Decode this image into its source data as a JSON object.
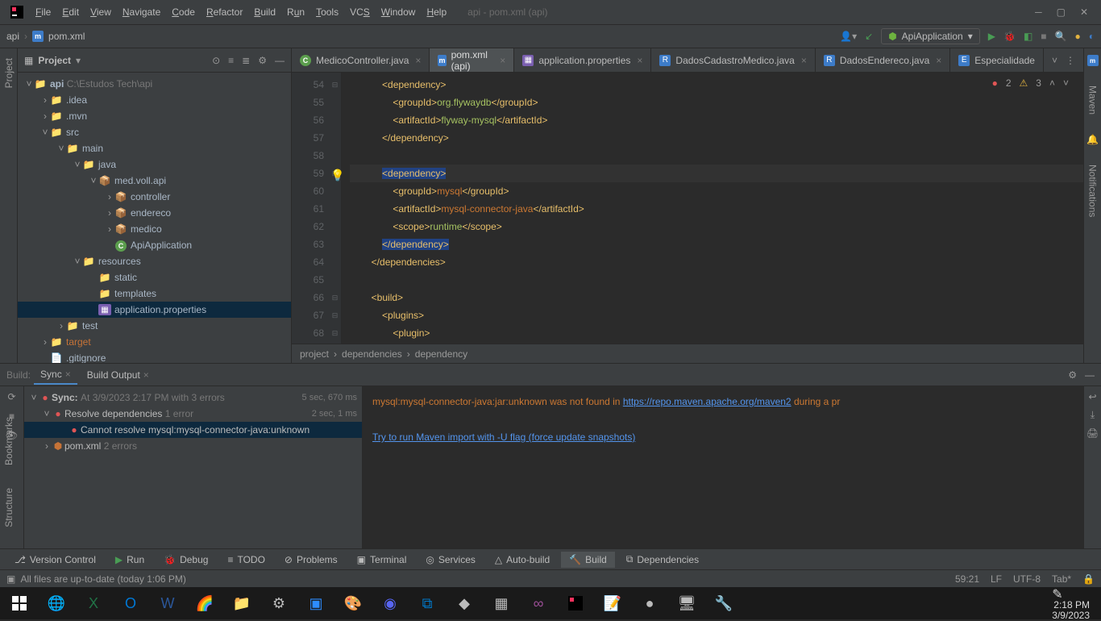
{
  "window": {
    "title": "api - pom.xml (api)"
  },
  "menu": [
    "File",
    "Edit",
    "View",
    "Navigate",
    "Code",
    "Refactor",
    "Build",
    "Run",
    "Tools",
    "VCS",
    "Window",
    "Help"
  ],
  "breadcrumb": {
    "root": "api",
    "file": "pom.xml"
  },
  "run_config": "ApiApplication",
  "project_panel": {
    "title": "Project"
  },
  "tree": {
    "root": {
      "name": "api",
      "path": "C:\\Estudos Tech\\api"
    },
    "idea": ".idea",
    "mvn": ".mvn",
    "src": "src",
    "main": "main",
    "java": "java",
    "pkg": "med.voll.api",
    "controller": "controller",
    "endereco": "endereco",
    "medico": "medico",
    "appclass": "ApiApplication",
    "resources": "resources",
    "static": "static",
    "templates": "templates",
    "appprops": "application.properties",
    "test": "test",
    "target": "target",
    "gitignore": ".gitignore"
  },
  "tabs": [
    {
      "label": "MedicoController.java",
      "active": false,
      "type": "c"
    },
    {
      "label": "pom.xml (api)",
      "active": true,
      "type": "m"
    },
    {
      "label": "application.properties",
      "active": false,
      "type": "p"
    },
    {
      "label": "DadosCadastroMedico.java",
      "active": false,
      "type": "r"
    },
    {
      "label": "DadosEndereco.java",
      "active": false,
      "type": "r"
    },
    {
      "label": "Especialidade",
      "active": false,
      "type": "r"
    }
  ],
  "inspector": {
    "errors": "2",
    "warnings": "3"
  },
  "code": {
    "lines": [
      54,
      55,
      56,
      57,
      58,
      59,
      60,
      61,
      62,
      63,
      64,
      65,
      66,
      67,
      68
    ],
    "content": [
      {
        "indent": 12,
        "html": "<span class='t-tag'>&lt;dependency&gt;</span>"
      },
      {
        "indent": 16,
        "html": "<span class='t-tag'>&lt;groupId&gt;</span><span class='t-val'>org.flywaydb</span><span class='t-tag'>&lt;/groupId&gt;</span>"
      },
      {
        "indent": 16,
        "html": "<span class='t-tag'>&lt;artifactId&gt;</span><span class='t-val'>flyway-mysql</span><span class='t-tag'>&lt;/artifactId&gt;</span>"
      },
      {
        "indent": 12,
        "html": "<span class='t-tag'>&lt;/dependency&gt;</span>"
      },
      {
        "indent": 0,
        "html": ""
      },
      {
        "indent": 12,
        "html": "<span class='t-tag t-hl'>&lt;dependency&gt;</span>",
        "current": true
      },
      {
        "indent": 16,
        "html": "<span class='t-tag'>&lt;groupId&gt;</span><span class='t-err'>mysql</span><span class='t-tag'>&lt;/groupId&gt;</span>"
      },
      {
        "indent": 16,
        "html": "<span class='t-tag'>&lt;artifactId&gt;</span><span class='t-err'>mysql-connector-java</span><span class='t-tag'>&lt;/artifactId&gt;</span>"
      },
      {
        "indent": 16,
        "html": "<span class='t-tag'>&lt;scope&gt;</span><span class='t-val'>runtime</span><span class='t-tag'>&lt;/scope&gt;</span>"
      },
      {
        "indent": 12,
        "html": "<span class='t-tag t-hl'>&lt;/dependency&gt;</span>"
      },
      {
        "indent": 8,
        "html": "<span class='t-tag'>&lt;/dependencies&gt;</span>"
      },
      {
        "indent": 0,
        "html": ""
      },
      {
        "indent": 8,
        "html": "<span class='t-tag'>&lt;build&gt;</span>"
      },
      {
        "indent": 12,
        "html": "<span class='t-tag'>&lt;plugins&gt;</span>"
      },
      {
        "indent": 16,
        "html": "<span class='t-tag'>&lt;plugin&gt;</span>"
      }
    ]
  },
  "structure_crumb": [
    "project",
    "dependencies",
    "dependency"
  ],
  "build_tabs": {
    "build": "Build:",
    "sync": "Sync",
    "output": "Build Output"
  },
  "build_tree": {
    "sync": {
      "label": "Sync:",
      "detail": "At 3/9/2023 2:17 PM with 3 errors",
      "time": "5 sec, 670 ms"
    },
    "resolve": {
      "label": "Resolve dependencies",
      "detail": "1 error",
      "time": "2 sec, 1 ms"
    },
    "cannot": "Cannot resolve mysql:mysql-connector-java:unknown",
    "pom": {
      "label": "pom.xml",
      "detail": "2 errors"
    }
  },
  "build_output": {
    "line1a": "mysql:mysql-connector-java:jar:unknown was not found in ",
    "line1b": "https://repo.maven.apache.org/maven2",
    "line1c": " during a pr",
    "line2": "Try to run Maven import with -U flag (force update snapshots)"
  },
  "tool_windows": [
    "Version Control",
    "Run",
    "Debug",
    "TODO",
    "Problems",
    "Terminal",
    "Services",
    "Auto-build",
    "Build",
    "Dependencies"
  ],
  "status": {
    "left": "All files are up-to-date (today 1:06 PM)",
    "pos": "59:21",
    "le": "LF",
    "enc": "UTF-8",
    "tab": "Tab*"
  },
  "side_left": [
    "Project",
    "Bookmarks",
    "Structure"
  ],
  "side_right": [
    "Maven",
    "Notifications"
  ],
  "clock": {
    "time": "2:18 PM",
    "date": "3/9/2023"
  }
}
